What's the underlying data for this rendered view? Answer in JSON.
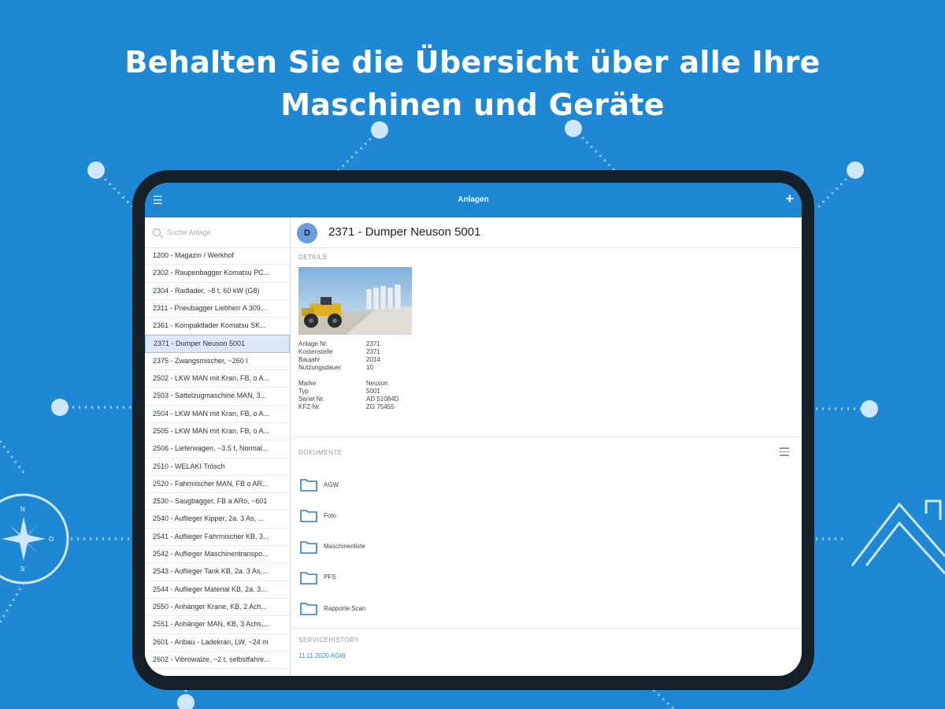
{
  "headline": {
    "line1": "Behalten Sie die Übersicht über alle Ihre",
    "line2": "Maschinen und Geräte"
  },
  "colors": {
    "background": "#1e88d4",
    "accent": "#1e88d4",
    "bezel": "#15202b"
  },
  "compass": {
    "n": "N",
    "o": "O",
    "s": "S"
  },
  "appbar": {
    "menu_icon": "☰",
    "title": "Anlagen",
    "add_icon": "+"
  },
  "search": {
    "placeholder": "Suche Anlage"
  },
  "sidebar": {
    "items": [
      "1200 - Magazin / Werkhof",
      "2302 - Raupenbagger Komatsu PC...",
      "2304 - Radlader, ~8 t, 60 kW (G8)",
      "2311 - Pneubagger Liebherr A 309...",
      "2361 - Kompaktlader Komatsu SK...",
      "2371 - Dumper Neuson 5001",
      "2375 - Zwangsmischer, ~260 l",
      "2502 - LKW MAN mit Kran, FB, o A...",
      "2503 - Sattelzugmaschine MAN, 3...",
      "2504 - LKW MAN mit Kran, FB, o A...",
      "2505 - LKW MAN mit Kran, FB, o A...",
      "2506 - Lieferwagen, ~3.5 t, Normal...",
      "2510 - WELAKI Trösch",
      "2520 - Fahrmischer MAN, FB o AR...",
      "2530 - Saugbagger, FB a ARo, ~601",
      "2540 - Auflieger Kipper, 2a. 3 As, ...",
      "2541 - Auflieger Fahrmischer KB, 3...",
      "2542 - Auflieger Maschinentranspo...",
      "2543 - Auflieger Tank KB, 2a. 3 As,...",
      "2544 - Auflieger Material KB, 2a. 3...",
      "2550 - Anhänger Krane, KB, 2 Ach...",
      "2551 - Anhänger MAN, KB, 3 Achs,...",
      "2601 - Anbau - Ladekran, LW, ~24 m",
      "2602 - Vibrowalze, ~2 t, selbstfahre..."
    ],
    "selected_index": 5
  },
  "detail": {
    "avatar": "D",
    "title": "2371 - Dumper Neuson 5001",
    "details_label": "DETAILS",
    "props1": [
      {
        "k": "Anlage Nr.",
        "v": "2371"
      },
      {
        "k": "Kostenstelle",
        "v": "2371"
      },
      {
        "k": "Baujahr",
        "v": "2014"
      },
      {
        "k": "Nutzungsdauer",
        "v": "10"
      }
    ],
    "props2": [
      {
        "k": "Marke",
        "v": "Neuson"
      },
      {
        "k": "Typ",
        "v": "5001"
      },
      {
        "k": "Seriel Nr.",
        "v": "AD 51084D"
      },
      {
        "k": "KFZ-Nr.",
        "v": "ZG 75455"
      }
    ],
    "documents_label": "DOKUMENTE",
    "documents": [
      "AGW",
      "Foto",
      "Maschinenliste",
      "PFS",
      "Rapporte Scan"
    ],
    "servicehistory_label": "SERVICEHISTORY",
    "service_entry": "11.11.2020 AGW"
  }
}
